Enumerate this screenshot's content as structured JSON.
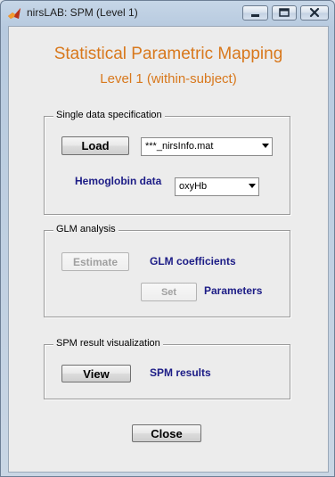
{
  "window": {
    "title": "nirsLAB:  SPM (Level 1)",
    "accent_title_color": "#d8781c",
    "label_color": "#1c1c86"
  },
  "header": {
    "title": "Statistical Parametric Mapping",
    "subtitle": "Level 1  (within-subject)"
  },
  "single_data": {
    "legend": "Single data specification",
    "load_label": "Load",
    "file_select": "***_nirsInfo.mat",
    "hemoglobin_label": "Hemoglobin data",
    "hemoglobin_select": "oxyHb"
  },
  "glm": {
    "legend": "GLM analysis",
    "estimate_label": "Estimate",
    "coefficients_label": "GLM coefficients",
    "set_label": "Set",
    "parameters_label": "Parameters"
  },
  "spm_vis": {
    "legend": "SPM result visualization",
    "view_label": "View",
    "results_label": "SPM results"
  },
  "footer": {
    "close_label": "Close"
  },
  "icons": {
    "app": "matlab-logo-icon",
    "minimize": "minimize-icon",
    "maximize": "maximize-icon",
    "close": "close-icon"
  }
}
